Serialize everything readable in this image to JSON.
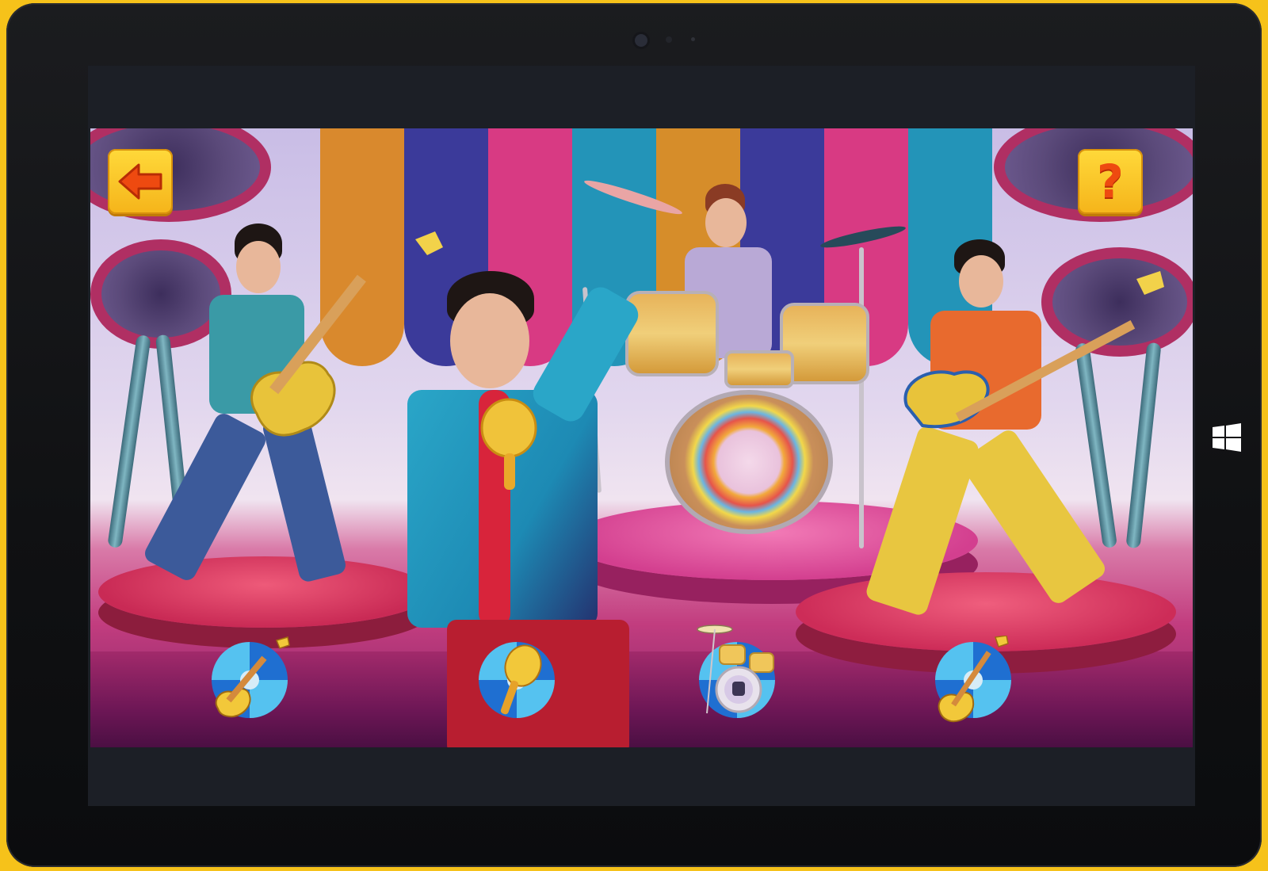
{
  "device": {
    "frame_color": "#15161a",
    "background_color": "#f6c21a",
    "windows_button_icon": "windows-logo-icon"
  },
  "game": {
    "top_bar": {
      "back_icon": "arrow-left-icon",
      "help_label": "?"
    },
    "scene": "band-stage",
    "instrument_buttons": [
      {
        "name": "electric-guitar",
        "icon": "guitar-icon"
      },
      {
        "name": "maraca",
        "icon": "maraca-icon"
      },
      {
        "name": "drum-kit",
        "icon": "drum-kit-icon"
      },
      {
        "name": "bass-guitar",
        "icon": "bass-guitar-icon"
      }
    ],
    "colors": {
      "button_yellow": "#ffd93a",
      "arrow_orange": "#ee4a10",
      "disc_blue": "#1f6fd1",
      "disc_light_blue": "#55c2f0"
    }
  }
}
